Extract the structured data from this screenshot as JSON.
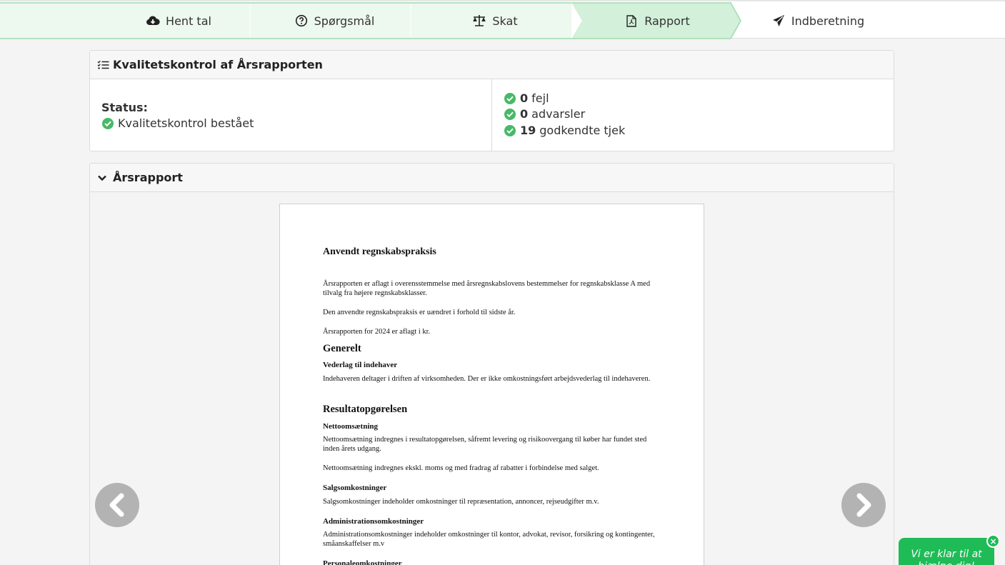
{
  "stepper": {
    "steps": [
      {
        "label": "Hent tal",
        "icon": "cloud-download-icon"
      },
      {
        "label": "Spørgsmål",
        "icon": "question-circle-icon"
      },
      {
        "label": "Skat",
        "icon": "scale-icon"
      },
      {
        "label": "Rapport",
        "icon": "pdf-file-icon"
      },
      {
        "label": "Indberetning",
        "icon": "paper-plane-icon"
      }
    ],
    "active_index": 3,
    "colors": {
      "done": "#edf8ef",
      "active": "#d3f0da",
      "border": "#9fdcae"
    }
  },
  "quality": {
    "title": "Kvalitetskontrol af Årsrapporten",
    "status_label": "Status:",
    "status_text": "Kvalitetskontrol bestået",
    "metrics": [
      {
        "count": "0",
        "label": "fejl"
      },
      {
        "count": "0",
        "label": "advarsler"
      },
      {
        "count": "19",
        "label": "godkendte tjek"
      }
    ],
    "check_color": "#47b968"
  },
  "report": {
    "title": "Årsrapport",
    "page": {
      "heading": "Anvendt regnskabspraksis",
      "p1": "Årsrapporten er aflagt i overensstemmelse med årsregnskabslovens bestemmelser for regnskabsklasse A med tilvalg fra højere regnskabsklasser.",
      "p2": "Den anvendte regnskabspraksis er uændret i forhold til sidste år.",
      "p3": "Årsrapporten for 2024 er aflagt i kr.",
      "generelt": "Generelt",
      "vederlag_title": "Vederlag til indehaver",
      "vederlag_text": "Indehaveren deltager i driften af virksomheden. Der er ikke omkostningsført arbejdsvederlag til indehaveren.",
      "resultat": "Resultatopgørelsen",
      "netto_title": "Nettoomsætning",
      "netto_text1": "Nettoomsætning indregnes i resultatopgørelsen, såfremt levering og risikoovergang til køber har fundet sted inden årets udgang.",
      "netto_text2": "Nettoomsætning indregnes ekskl. moms og med fradrag af rabatter i forbindelse med salget.",
      "salg_title": "Salgsomkostninger",
      "salg_text": "Salgsomkostninger indeholder omkostninger til repræsentation, annoncer, rejseudgifter m.v.",
      "admin_title": "Administrationsomkostninger",
      "admin_text": "Administrationsomkostninger indeholder omkostninger til kontor, advokat, revisor, forsikring og kontingenter, småanskaffelser m.v",
      "personale_title": "Personaleomkostninger"
    }
  },
  "chat": {
    "text": "Vi er klar til at hjælpe dig!",
    "close": "×"
  }
}
